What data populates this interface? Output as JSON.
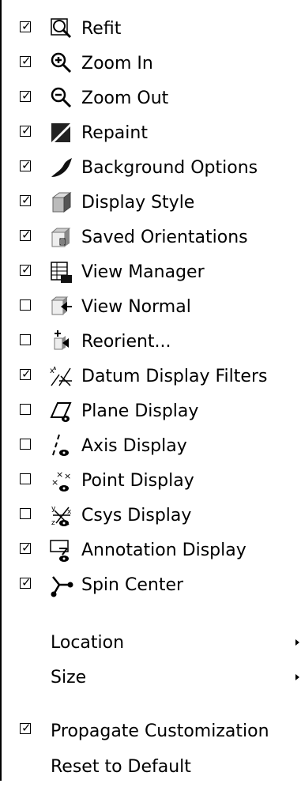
{
  "items": [
    {
      "label": "Refit",
      "checked": true,
      "icon": "refit-icon"
    },
    {
      "label": "Zoom In",
      "checked": true,
      "icon": "zoom-in-icon"
    },
    {
      "label": "Zoom Out",
      "checked": true,
      "icon": "zoom-out-icon"
    },
    {
      "label": "Repaint",
      "checked": true,
      "icon": "repaint-icon"
    },
    {
      "label": "Background Options",
      "checked": true,
      "icon": "background-icon"
    },
    {
      "label": "Display Style",
      "checked": true,
      "icon": "display-style-icon"
    },
    {
      "label": "Saved Orientations",
      "checked": true,
      "icon": "saved-orientations-icon"
    },
    {
      "label": "View Manager",
      "checked": true,
      "icon": "view-manager-icon"
    },
    {
      "label": "View Normal",
      "checked": false,
      "icon": "view-normal-icon"
    },
    {
      "label": "Reorient...",
      "checked": false,
      "icon": "reorient-icon"
    },
    {
      "label": "Datum Display Filters",
      "checked": true,
      "icon": "datum-filters-icon"
    },
    {
      "label": "Plane Display",
      "checked": false,
      "icon": "plane-display-icon"
    },
    {
      "label": "Axis Display",
      "checked": false,
      "icon": "axis-display-icon"
    },
    {
      "label": "Point Display",
      "checked": false,
      "icon": "point-display-icon"
    },
    {
      "label": "Csys Display",
      "checked": false,
      "icon": "csys-display-icon"
    },
    {
      "label": "Annotation Display",
      "checked": true,
      "icon": "annotation-display-icon"
    },
    {
      "label": "Spin Center",
      "checked": true,
      "icon": "spin-center-icon"
    }
  ],
  "submenus": [
    {
      "label": "Location"
    },
    {
      "label": "Size"
    }
  ],
  "footer": {
    "propagate_label": "Propagate Customization",
    "propagate_checked": true,
    "reset_label": "Reset to Default"
  },
  "check_glyph": "☑"
}
